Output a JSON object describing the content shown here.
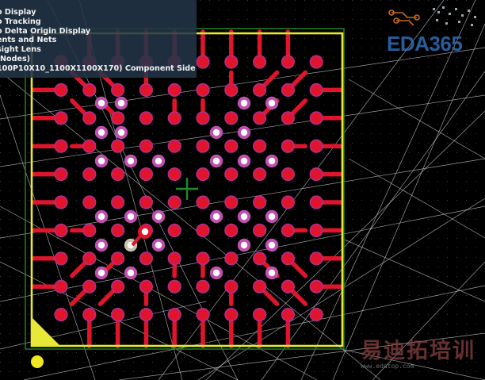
{
  "hud": {
    "lines": [
      "o Display",
      "o Tracking",
      "o Delta Origin Display",
      "ents and Nets",
      "sight Lens",
      "-Nodes)",
      "100P10X10_1100X1100X170)  Component Side"
    ]
  },
  "logo": {
    "text": "EDA365"
  },
  "watermark": {
    "text": "易迪拓培训",
    "url": "www.edatop.com"
  },
  "colors": {
    "background": "#000000",
    "board_outline": "#e8e838",
    "pad_red": "#e0152c",
    "via_ring": "#b32d8e",
    "ratsnest": "#cfcfcf",
    "green_overlay": "#1e8a2a",
    "grid_dot": "#4a4a4a",
    "hud_bg": "#233448"
  },
  "icons": {
    "cursor": "crosshair-icon",
    "origin": "origin-marker-icon",
    "pin1": "pin1-triangle-icon"
  }
}
